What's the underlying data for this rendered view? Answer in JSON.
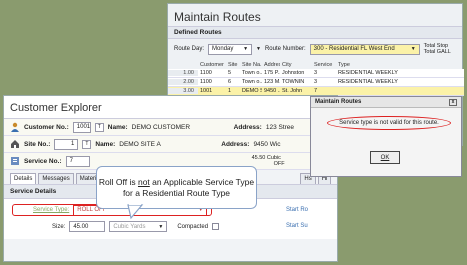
{
  "routes_window": {
    "title": "Maintain Routes",
    "section": "Defined Routes",
    "route_day_label": "Route Day:",
    "route_day_value": "Monday",
    "route_number_label": "Route Number:",
    "route_number_value": "300 - Residential FL West End",
    "totals": [
      "Total Stop",
      "Total GALL"
    ],
    "columns": [
      "",
      "Customer",
      "Site",
      "Site Na...",
      "Address",
      "City",
      "Service",
      "Type"
    ],
    "rows": [
      [
        "1.00",
        "1100",
        "5",
        "Town o...",
        "175 P...",
        "Johnston",
        "3",
        "RESIDENTIAL WEEKLY"
      ],
      [
        "2.00",
        "1100",
        "6",
        "Town o...",
        "123 M...",
        "TOWNIN",
        "3",
        "RESIDENTIAL WEEKLY"
      ],
      [
        "3.00",
        "1001",
        "1",
        "DEMO S...",
        "9450 ...",
        "St. John",
        "7",
        ""
      ]
    ]
  },
  "dialog": {
    "title": "Maintain Routes",
    "close": "x",
    "message": "Service type is not valid for this route.",
    "ok": "OK"
  },
  "explorer": {
    "title": "Customer Explorer",
    "customer_label": "Customer No.:",
    "customer_no": "1001",
    "customer_name_label": "Name:",
    "customer_name": "DEMO CUSTOMER",
    "customer_address_label": "Address:",
    "customer_address": "123 Stree",
    "site_label": "Site No.:",
    "site_no": "1",
    "site_name_label": "Name:",
    "site_name": "DEMO SITE A",
    "site_address_label": "Address:",
    "site_address": "9450 Wic",
    "service_label": "Service No.:",
    "service_no": "7",
    "service_side_top": "45.50 Cubic",
    "service_side_bottom": "OFF",
    "tabs": [
      "Details",
      "Messages",
      "Materi",
      "Hs",
      "Hi"
    ],
    "section": "Service Details",
    "service_type_label": "Service Type:",
    "service_type_value": "ROLL OFF",
    "size_label": "Size:",
    "size_value": "45.00",
    "unit_value": "Cubic Yards",
    "compacted_label": "Compacted",
    "start_ro": "Start Ro",
    "start_su": "Start Su"
  },
  "callout": {
    "line1_before": "Roll Off is ",
    "line1_under": "not",
    "line1_after": " an Applicable Service Type",
    "line2": "for a Residential Route Type"
  },
  "colors": {
    "background": "#8a9b6e",
    "highlight": "#fbf2a8",
    "error": "#dd2222",
    "callout_border": "#8aa3c8"
  }
}
